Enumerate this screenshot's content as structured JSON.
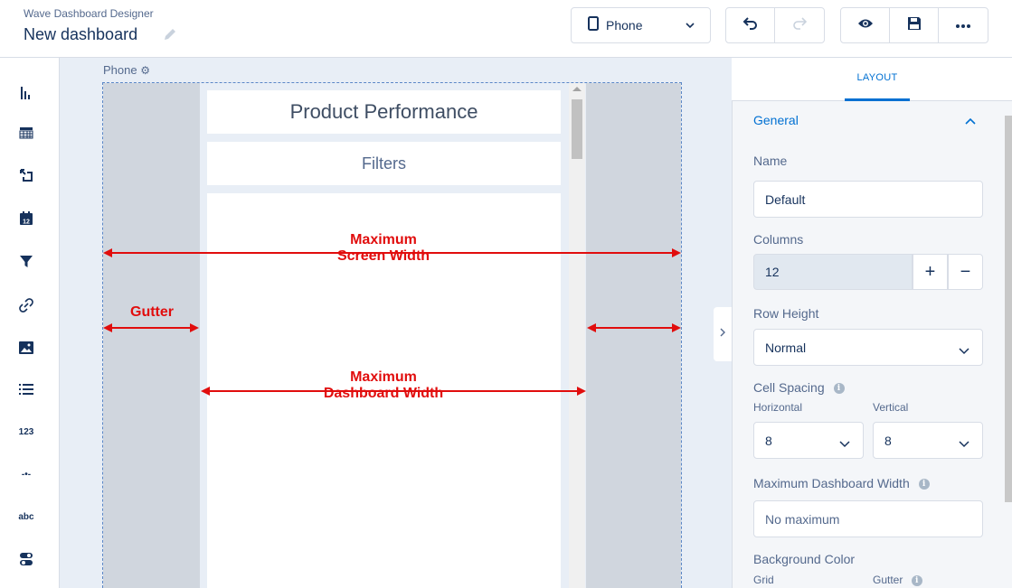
{
  "header": {
    "app_name": "Wave Dashboard Designer",
    "dashboard_title": "New dashboard",
    "device_selector": {
      "value": "Phone"
    },
    "icons": [
      "phone-icon",
      "chevron-down-icon",
      "undo-icon",
      "redo-icon",
      "preview-eye-icon",
      "save-disk-icon",
      "more-icon"
    ]
  },
  "tool_rail": {
    "items": [
      {
        "name": "chart-tool",
        "icon": "bar-chart-icon"
      },
      {
        "name": "table-tool",
        "icon": "table-icon"
      },
      {
        "name": "compare-table-tool",
        "icon": "pivot-icon"
      },
      {
        "name": "date-tool",
        "icon": "calendar-icon",
        "text": "12"
      },
      {
        "name": "filter-tool",
        "icon": "filter-icon"
      },
      {
        "name": "link-tool",
        "icon": "link-icon"
      },
      {
        "name": "image-tool",
        "icon": "image-icon"
      },
      {
        "name": "list-tool",
        "icon": "list-icon"
      },
      {
        "name": "number-tool",
        "icon": "number-icon",
        "text": "123"
      },
      {
        "name": "range-tool",
        "icon": "range-icon",
        "text": "-•-"
      },
      {
        "name": "text-tool",
        "icon": "text-icon",
        "text": "abc"
      },
      {
        "name": "toggle-tool",
        "icon": "toggle-icon"
      }
    ]
  },
  "canvas": {
    "device_label": "Phone",
    "widgets": {
      "title": "Product Performance",
      "filters": "Filters"
    },
    "annotations": {
      "max_screen_width_line1": "Maximum",
      "max_screen_width_line2": "Screen Width",
      "gutter": "Gutter",
      "max_dash_width_line1": "Maximum",
      "max_dash_width_line2": "Dashboard Width"
    },
    "annotation_color": "#e10d0d"
  },
  "panel": {
    "tab": "LAYOUT",
    "section": "General",
    "name_label": "Name",
    "name_value": "Default",
    "columns_label": "Columns",
    "columns_value": "12",
    "row_height_label": "Row Height",
    "row_height_value": "Normal",
    "cell_spacing_label": "Cell Spacing",
    "horizontal_label": "Horizontal",
    "horizontal_value": "8",
    "vertical_label": "Vertical",
    "vertical_value": "8",
    "max_width_label": "Maximum Dashboard Width",
    "max_width_placeholder": "No maximum",
    "bg_color_label": "Background Color",
    "grid_label": "Grid",
    "gutter_label": "Gutter"
  },
  "colors": {
    "accent": "#0070d2",
    "text": "#16325c",
    "gutter_fill": "#d0d6de"
  }
}
